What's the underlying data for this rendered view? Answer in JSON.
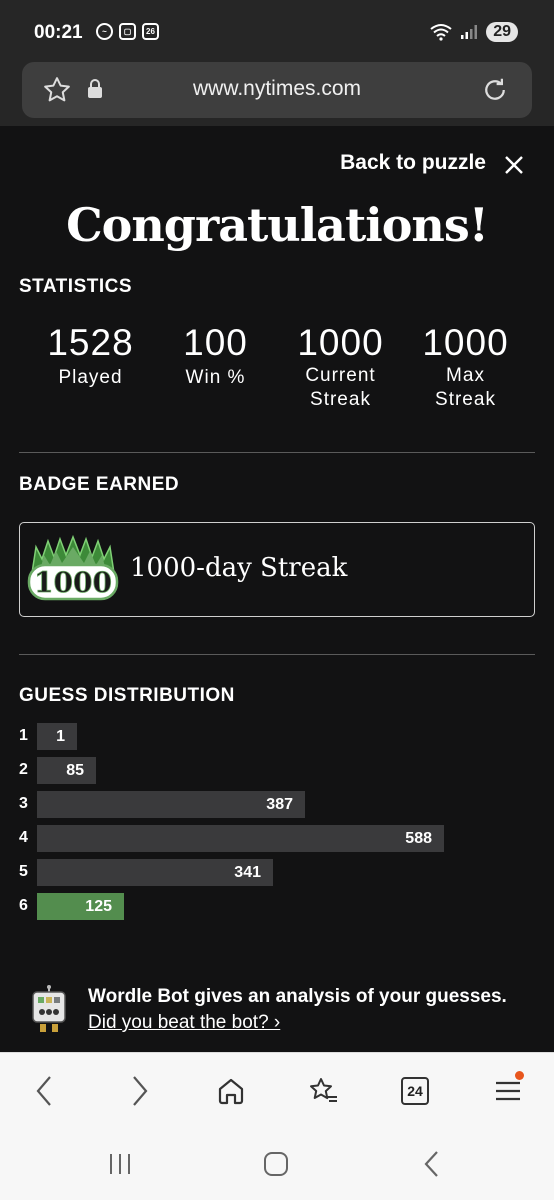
{
  "status_bar": {
    "time": "00:21",
    "calendar_day": "26",
    "battery": "29"
  },
  "browser": {
    "url": "www.nytimes.com",
    "tab_count": "24"
  },
  "modal": {
    "back_link": "Back to puzzle",
    "heading": "Congratulations!",
    "statistics_title": "STATISTICS",
    "stats": [
      {
        "value": "1528",
        "label": "Played"
      },
      {
        "value": "100",
        "label": "Win %"
      },
      {
        "value": "1000",
        "label": "Current Streak"
      },
      {
        "value": "1000",
        "label": "Max Streak"
      }
    ],
    "badge_title": "BADGE EARNED",
    "badge": {
      "number": "1000",
      "label": "1000-day Streak"
    },
    "distribution_title": "GUESS DISTRIBUTION",
    "distribution": [
      {
        "guess": "1",
        "count": 1
      },
      {
        "guess": "2",
        "count": 85
      },
      {
        "guess": "3",
        "count": 387
      },
      {
        "guess": "4",
        "count": 588
      },
      {
        "guess": "5",
        "count": 341
      },
      {
        "guess": "6",
        "count": 125,
        "highlight": true
      }
    ],
    "bot": {
      "headline": "Wordle Bot gives an analysis of your guesses.",
      "link": "Did you beat the bot? ›"
    }
  },
  "colors": {
    "background": "#121213",
    "bar": "#3a3a3c",
    "highlight_bar": "#538d4e",
    "badge_green": "#6aaa64"
  },
  "icons": [
    "star-icon",
    "lock-icon",
    "reload-icon",
    "close-icon",
    "back-arrow-icon",
    "forward-arrow-icon",
    "home-icon",
    "bookmarks-icon",
    "tabs-icon",
    "menu-icon"
  ]
}
